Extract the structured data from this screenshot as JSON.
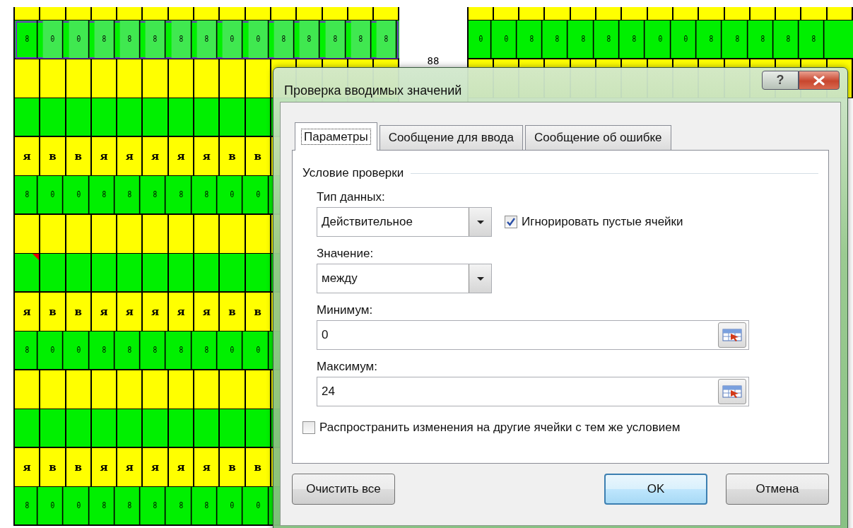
{
  "sheet": {
    "left": {
      "rows": [
        {
          "kind": "band",
          "selected": false,
          "note": false
        },
        {
          "kind": "digits",
          "selected": true,
          "note": false,
          "cells": [
            "8",
            "0",
            "0",
            "8",
            "8",
            "8",
            "8",
            "8",
            "0",
            "0",
            "8",
            "8",
            "8",
            "8",
            "8"
          ]
        },
        {
          "kind": "band",
          "selected": false,
          "note": false
        },
        {
          "kind": "fill",
          "selected": false,
          "note": false
        },
        {
          "kind": "letters",
          "selected": false,
          "note": false,
          "cells": [
            "я",
            "в",
            "в",
            "я",
            "я",
            "я",
            "я",
            "я",
            "в",
            "в"
          ]
        },
        {
          "kind": "digits",
          "selected": false,
          "note": false,
          "cells": [
            "8",
            "0",
            "0",
            "8",
            "8",
            "8",
            "8",
            "8",
            "0",
            "0"
          ]
        },
        {
          "kind": "band",
          "selected": false,
          "note": false
        },
        {
          "kind": "fill",
          "selected": false,
          "note": true
        },
        {
          "kind": "letters",
          "selected": false,
          "note": false,
          "cells": [
            "я",
            "в",
            "в",
            "я",
            "я",
            "я",
            "я",
            "я",
            "в",
            "в"
          ]
        },
        {
          "kind": "digits",
          "selected": false,
          "note": false,
          "cells": [
            "8",
            "0",
            "0",
            "8",
            "8",
            "8",
            "8",
            "8",
            "0",
            "0"
          ]
        },
        {
          "kind": "band",
          "selected": false,
          "note": false
        },
        {
          "kind": "fill",
          "selected": false,
          "note": false
        },
        {
          "kind": "letters",
          "selected": false,
          "note": false,
          "cells": [
            "я",
            "в",
            "в",
            "я",
            "я",
            "я",
            "я",
            "я",
            "в",
            "в"
          ]
        },
        {
          "kind": "digits",
          "selected": false,
          "note": false,
          "cells": [
            "8",
            "0",
            "0",
            "8",
            "8",
            "8",
            "8",
            "8",
            "0",
            "0"
          ]
        }
      ]
    },
    "loose_text": "88",
    "right": {
      "rows": [
        {
          "kind": "band",
          "selected": false,
          "note": false
        },
        {
          "kind": "digits",
          "selected": false,
          "note": false,
          "cells": [
            "0",
            "0",
            "8",
            "8",
            "8",
            "8",
            "8",
            "0",
            "0",
            "8",
            "8",
            "8",
            "8",
            "8"
          ]
        },
        {
          "kind": "band",
          "selected": false,
          "note": false
        }
      ]
    }
  },
  "dialog": {
    "title": "Проверка вводимых значений",
    "help": "?",
    "tabs": [
      {
        "label": "Параметры",
        "selected": true
      },
      {
        "label": "Сообщение для ввода",
        "selected": false
      },
      {
        "label": "Сообщение об ошибке",
        "selected": false
      }
    ],
    "group_title": "Условие проверки",
    "data_type": {
      "label": "Тип данных:",
      "value": "Действительное"
    },
    "ignore_blank": {
      "label": "Игнорировать пустые ячейки",
      "checked": true
    },
    "operator": {
      "label": "Значение:",
      "value": "между"
    },
    "minimum": {
      "label": "Минимум:",
      "value": "0"
    },
    "maximum": {
      "label": "Максимум:",
      "value": "24"
    },
    "apply_all": {
      "label": "Распространить изменения на другие ячейки с тем же условием",
      "checked": false
    },
    "left_buttons": [
      {
        "label": "Очистить все",
        "default": false
      }
    ],
    "right_buttons": [
      {
        "label": "OK",
        "default": true
      },
      {
        "label": "Отмена",
        "default": false
      }
    ]
  }
}
